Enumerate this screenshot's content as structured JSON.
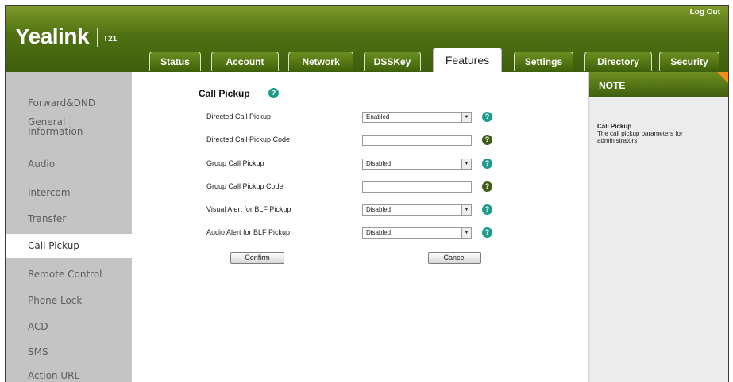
{
  "header": {
    "logo": "Yealink",
    "model": "T21",
    "logout": "Log Out",
    "tabs": [
      {
        "label": "Status"
      },
      {
        "label": "Account"
      },
      {
        "label": "Network"
      },
      {
        "label": "DSSKey"
      },
      {
        "label": "Features",
        "active": true
      },
      {
        "label": "Settings"
      },
      {
        "label": "Directory"
      },
      {
        "label": "Security"
      }
    ]
  },
  "sidebar": {
    "items": [
      {
        "label": "Forward&DND"
      },
      {
        "label": "General Information"
      },
      {
        "label": "Audio"
      },
      {
        "label": "Intercom"
      },
      {
        "label": "Transfer"
      },
      {
        "label": "Call Pickup",
        "active": true
      },
      {
        "label": "Remote Control"
      },
      {
        "label": "Phone Lock"
      },
      {
        "label": "ACD"
      },
      {
        "label": "SMS"
      },
      {
        "label": "Action URL"
      }
    ]
  },
  "main": {
    "section_title": "Call Pickup",
    "rows": [
      {
        "label": "Directed Call Pickup",
        "type": "select",
        "value": "Enabled"
      },
      {
        "label": "Directed Call Pickup Code",
        "type": "text",
        "value": ""
      },
      {
        "label": "Group Call Pickup",
        "type": "select",
        "value": "Disabled"
      },
      {
        "label": "Group Call Pickup Code",
        "type": "text",
        "value": ""
      },
      {
        "label": "Visual Alert for BLF Pickup",
        "type": "select",
        "value": "Disabled"
      },
      {
        "label": "Audio Alert for BLF Pickup",
        "type": "select",
        "value": "Disabled"
      }
    ],
    "confirm_label": "Confirm",
    "cancel_label": "Cancel"
  },
  "note": {
    "title": "NOTE",
    "heading": "Call Pickup",
    "text": "The call pickup parameters for administrators."
  },
  "colors": {
    "header_green": "#4f7112",
    "help_teal": "#1d9c8c",
    "note_corner": "#f28c1b",
    "sidebar_gray": "#c4c4c4"
  }
}
